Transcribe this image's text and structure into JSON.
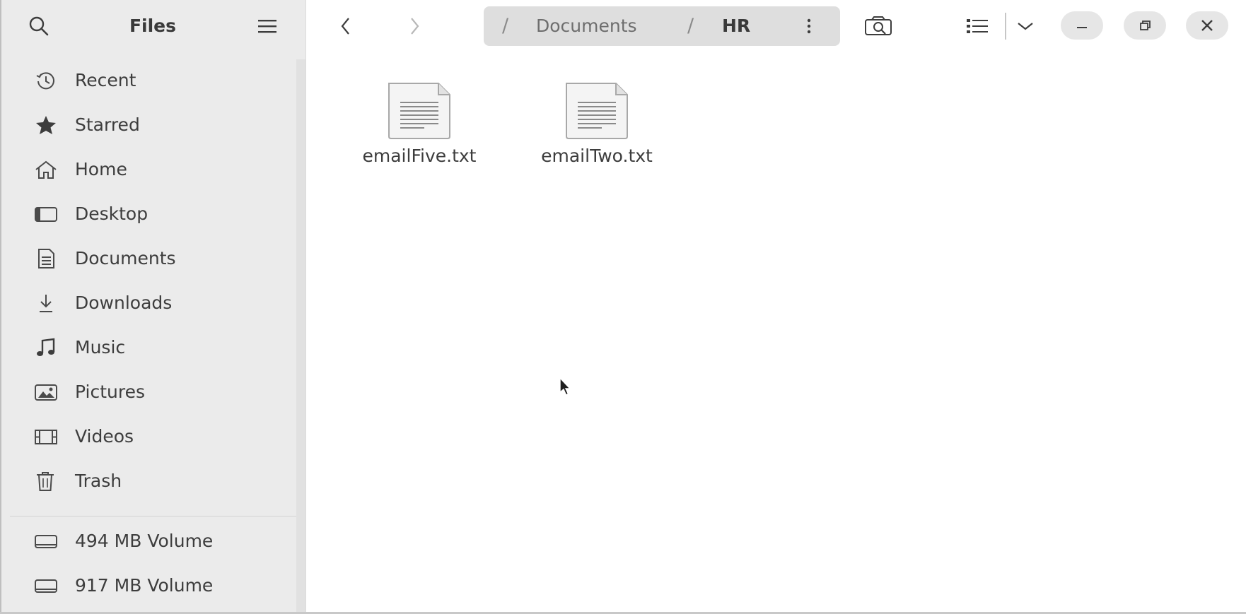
{
  "sidebar": {
    "title": "Files",
    "items": [
      {
        "label": "Recent",
        "icon": "clock-icon"
      },
      {
        "label": "Starred",
        "icon": "star-icon"
      },
      {
        "label": "Home",
        "icon": "home-icon"
      },
      {
        "label": "Desktop",
        "icon": "desktop-icon"
      },
      {
        "label": "Documents",
        "icon": "documents-icon"
      },
      {
        "label": "Downloads",
        "icon": "downloads-icon"
      },
      {
        "label": "Music",
        "icon": "music-icon"
      },
      {
        "label": "Pictures",
        "icon": "pictures-icon"
      },
      {
        "label": "Videos",
        "icon": "videos-icon"
      },
      {
        "label": "Trash",
        "icon": "trash-icon"
      }
    ],
    "volumes": [
      {
        "label": "494 MB Volume",
        "icon": "drive-icon"
      },
      {
        "label": "917 MB Volume",
        "icon": "drive-icon"
      }
    ]
  },
  "pathbar": {
    "root_sep": "/",
    "segments": [
      "Documents",
      "HR"
    ],
    "sep": "/"
  },
  "files": [
    {
      "name": "emailFive.txt",
      "icon": "text-file-icon"
    },
    {
      "name": "emailTwo.txt",
      "icon": "text-file-icon"
    }
  ]
}
